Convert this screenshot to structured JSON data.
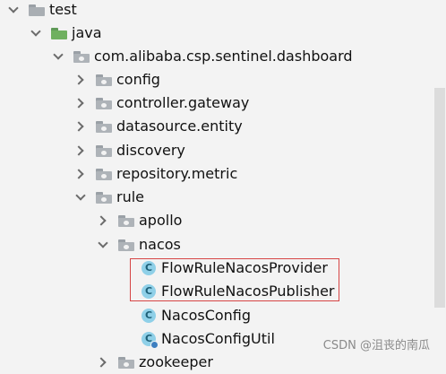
{
  "tree": {
    "items": [
      {
        "label": "test"
      },
      {
        "label": "java"
      },
      {
        "label": "com.alibaba.csp.sentinel.dashboard"
      },
      {
        "label": "config"
      },
      {
        "label": "controller.gateway"
      },
      {
        "label": "datasource.entity"
      },
      {
        "label": "discovery"
      },
      {
        "label": "repository.metric"
      },
      {
        "label": "rule"
      },
      {
        "label": "apollo"
      },
      {
        "label": "nacos"
      },
      {
        "label": "FlowRuleNacosProvider",
        "icon_text": "C"
      },
      {
        "label": "FlowRuleNacosPublisher",
        "icon_text": "C"
      },
      {
        "label": "NacosConfig",
        "icon_text": "C"
      },
      {
        "label": "NacosConfigUtil",
        "icon_text": "C"
      },
      {
        "label": "zookeeper"
      }
    ]
  },
  "watermark": "CSDN @沮丧的南瓜",
  "colors": {
    "highlight_border": "#d64545",
    "folder": "#a9aeb3",
    "source_folder": "#6fb05f",
    "class_icon": "#8fd0e8"
  }
}
